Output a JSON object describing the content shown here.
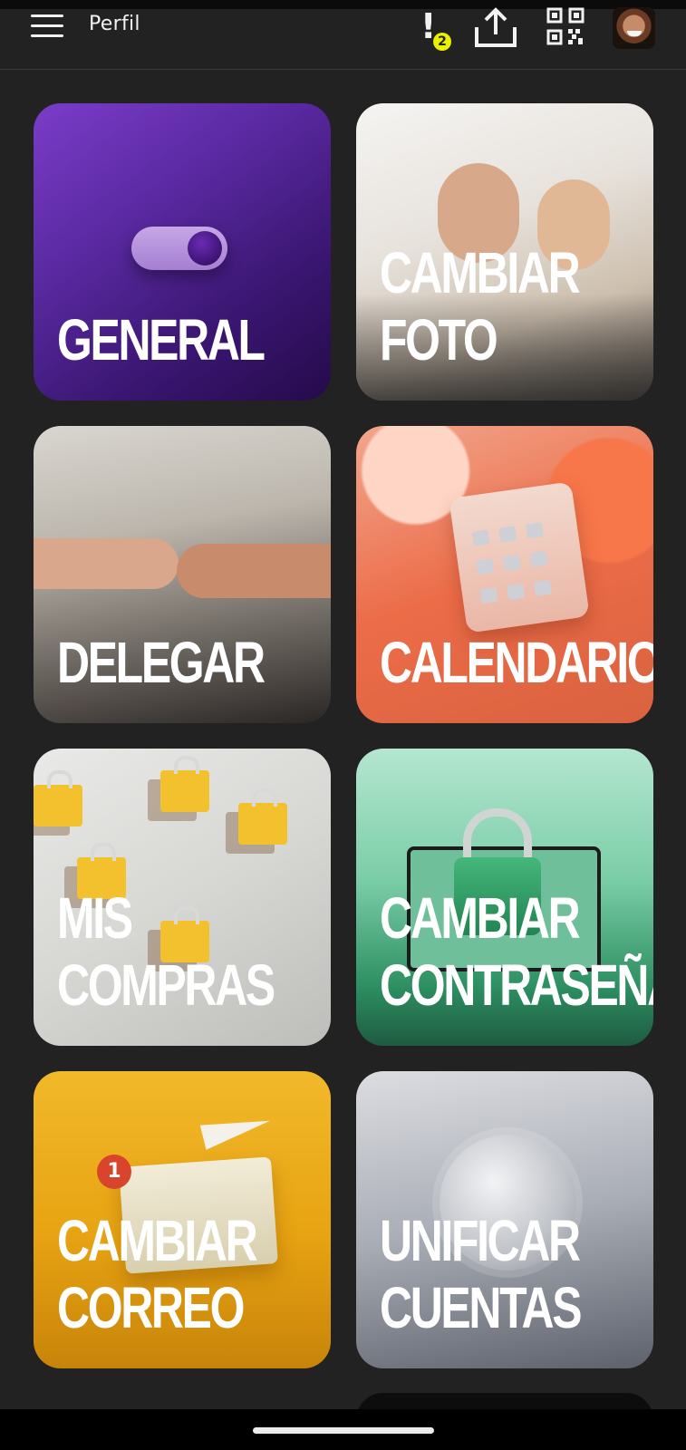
{
  "appbar": {
    "title": "Perfil",
    "alert_count": "2",
    "icons": [
      "menu-icon",
      "alert-icon",
      "share-icon",
      "qr-code-icon",
      "avatar"
    ]
  },
  "tiles": [
    {
      "label": "GENERAL"
    },
    {
      "label": "CAMBIAR\nFOTO"
    },
    {
      "label": "DELEGAR"
    },
    {
      "label": "CALENDARIOS"
    },
    {
      "label": "MIS COMPRAS"
    },
    {
      "label": "CAMBIAR\nCONTRASEÑA"
    },
    {
      "label": "CAMBIAR\nCORREO"
    },
    {
      "label": "UNIFICAR\nCUENTAS"
    }
  ],
  "decor": {
    "envelope_badge": "1"
  },
  "colors": {
    "background": "#222222",
    "badge": "#e9f000"
  }
}
